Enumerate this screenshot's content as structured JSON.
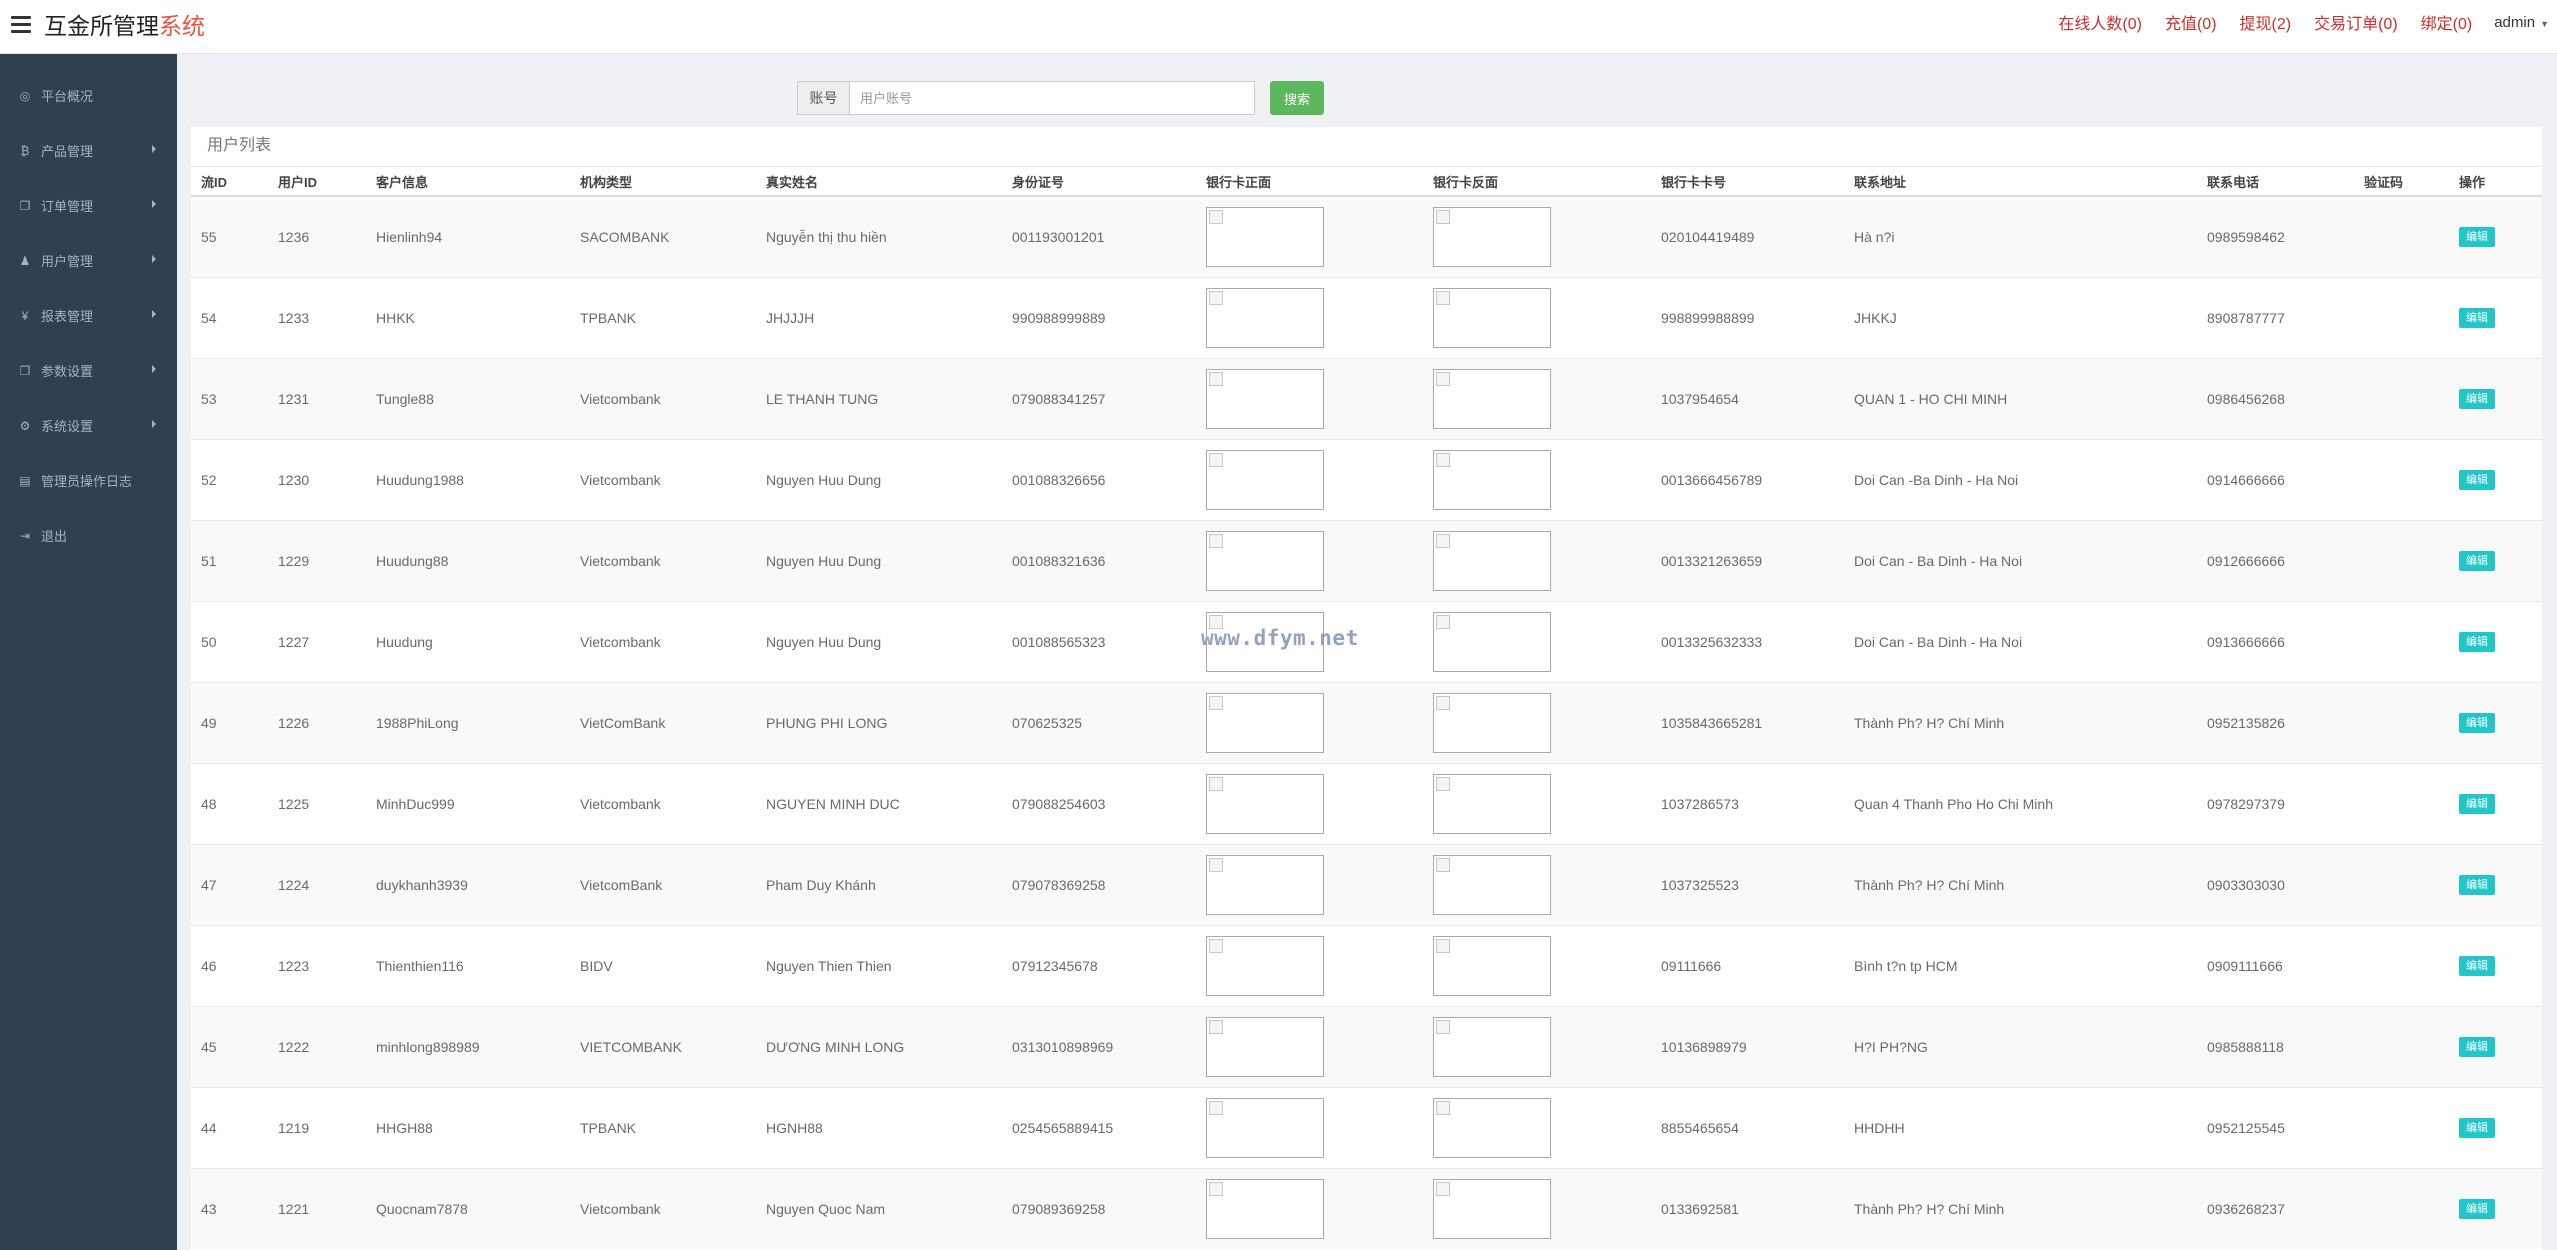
{
  "app": {
    "title_main": "互金所管理",
    "title_accent": "系统"
  },
  "topnav": {
    "online": "在线人数(0)",
    "recharge": "充值(0)",
    "withdraw": "提现(2)",
    "orders": "交易订单(0)",
    "bind": "绑定(0)",
    "admin": "admin"
  },
  "sidebar": {
    "items": [
      {
        "label": "平台概况",
        "icon": "dashboard-icon",
        "glyph": "◎",
        "has_sub": false
      },
      {
        "label": "产品管理",
        "icon": "bitcoin-icon",
        "glyph": "₿",
        "has_sub": true
      },
      {
        "label": "订单管理",
        "icon": "copy-icon",
        "glyph": "❐",
        "has_sub": true
      },
      {
        "label": "用户管理",
        "icon": "user-icon",
        "glyph": "♟",
        "has_sub": true
      },
      {
        "label": "报表管理",
        "icon": "yen-icon",
        "glyph": "¥",
        "has_sub": true
      },
      {
        "label": "参数设置",
        "icon": "files-icon",
        "glyph": "❐",
        "has_sub": true
      },
      {
        "label": "系统设置",
        "icon": "gears-icon",
        "glyph": "⚙",
        "has_sub": true
      },
      {
        "label": "管理员操作日志",
        "icon": "file-icon",
        "glyph": "▤",
        "has_sub": false
      },
      {
        "label": "退出",
        "icon": "sign-out-icon",
        "glyph": "⇥",
        "has_sub": false
      }
    ]
  },
  "search": {
    "addon": "账号",
    "placeholder": "用户账号",
    "button": "搜索"
  },
  "table": {
    "title": "用户列表",
    "columns": [
      "流ID",
      "用户ID",
      "客户信息",
      "机构类型",
      "真实姓名",
      "身份证号",
      "银行卡正面",
      "银行卡反面",
      "银行卡卡号",
      "联系地址",
      "联系电话",
      "验证码",
      "操作"
    ],
    "edit_label": "编辑",
    "rows": [
      [
        "55",
        "1236",
        "Hienlinh94",
        "SACOMBANK",
        "Nguyễn thị thu hiền",
        "001193001201",
        "020104419489",
        "Hà n?i",
        "0989598462"
      ],
      [
        "54",
        "1233",
        "HHKK",
        "TPBANK",
        "JHJJJH",
        "990988999889",
        "998899988899",
        "JHKKJ",
        "8908787777"
      ],
      [
        "53",
        "1231",
        "Tungle88",
        "Vietcombank",
        "LE THANH TUNG",
        "079088341257",
        "1037954654",
        "QUAN 1 - HO CHI MINH",
        "0986456268"
      ],
      [
        "52",
        "1230",
        "Huudung1988",
        "Vietcombank",
        "Nguyen Huu Dung",
        "001088326656",
        "0013666456789",
        "Doi Can -Ba Dinh - Ha Noi",
        "0914666666"
      ],
      [
        "51",
        "1229",
        "Huudung88",
        "Vietcombank",
        "Nguyen Huu Dung",
        "001088321636",
        "0013321263659",
        "Doi Can - Ba Dinh - Ha Noi",
        "0912666666"
      ],
      [
        "50",
        "1227",
        "Huudung",
        "Vietcombank",
        "Nguyen Huu Dung",
        "001088565323",
        "0013325632333",
        "Doi Can - Ba Dinh - Ha Noi",
        "0913666666"
      ],
      [
        "49",
        "1226",
        "1988PhiLong",
        "VietComBank",
        "PHUNG PHI LONG",
        "070625325",
        "1035843665281",
        "Thành Ph? H? Chí Minh",
        "0952135826"
      ],
      [
        "48",
        "1225",
        "MinhDuc999",
        "Vietcombank",
        "NGUYEN MINH DUC",
        "079088254603",
        "1037286573",
        "Quan 4 Thanh Pho Ho Chi Minh",
        "0978297379"
      ],
      [
        "47",
        "1224",
        "duykhanh3939",
        "VietcomBank",
        "Pham Duy Khánh",
        "079078369258",
        "1037325523",
        "Thành Ph? H? Chí Minh",
        "0903303030"
      ],
      [
        "46",
        "1223",
        "Thienthien116",
        "BIDV",
        "Nguyen Thien Thien",
        "07912345678",
        "09111666",
        "Bình t?n tp HCM",
        "0909111666"
      ],
      [
        "45",
        "1222",
        "minhlong898989",
        "VIETCOMBANK",
        "DƯƠNG MINH LONG",
        "0313010898969",
        "10136898979",
        "H?I PH?NG",
        "0985888118"
      ],
      [
        "44",
        "1219",
        "HHGH88",
        "TPBANK",
        "HGNH88",
        "0254565889415",
        "8855465654",
        "HHDHH",
        "0952125545"
      ],
      [
        "43",
        "1221",
        "Quocnam7878",
        "Vietcombank",
        "Nguyen Quoc Nam",
        "079089369258",
        "0133692581",
        "Thành Ph? H? Chí Minh",
        "0936268237"
      ]
    ]
  },
  "watermark": "www.dfym.net"
}
